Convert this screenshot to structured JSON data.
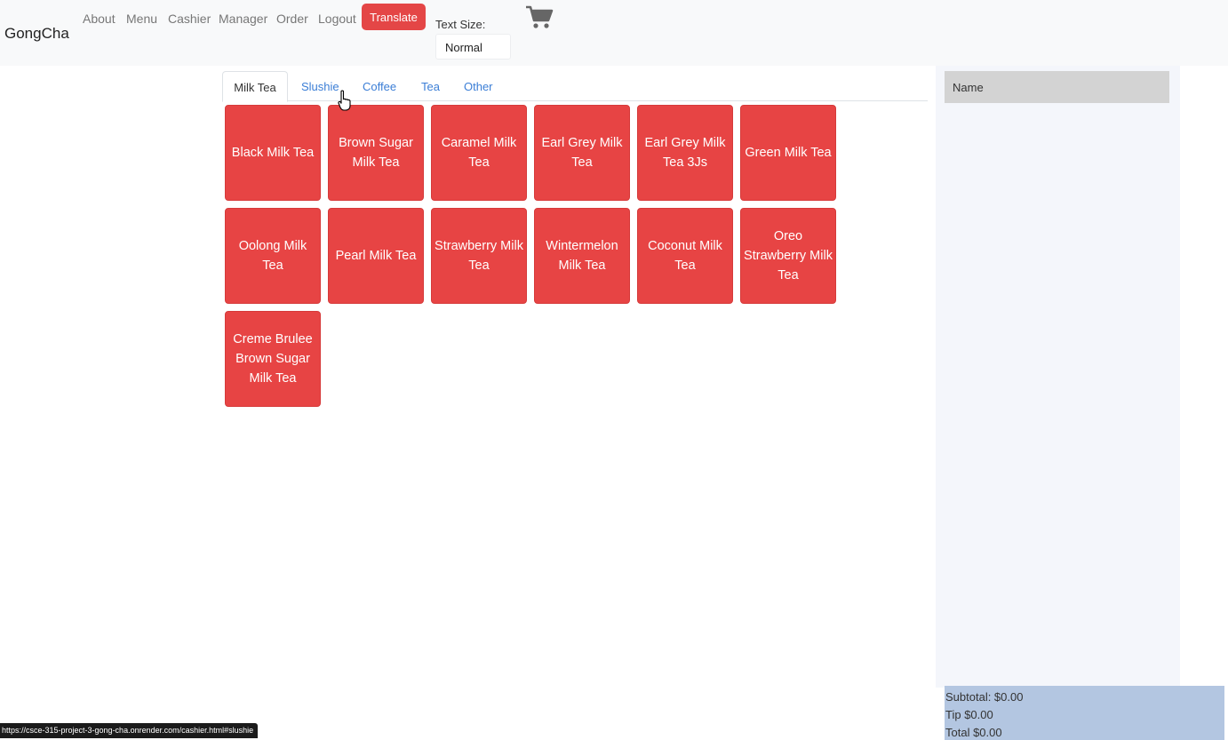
{
  "nav": {
    "brand": "GongCha",
    "links": [
      "About",
      "Menu",
      "Cashier",
      "Manager",
      "Order",
      "Logout"
    ],
    "translate": "Translate",
    "text_size_label": "Text Size:",
    "text_size_value": "Normal",
    "cart_icon": "shopping-cart-icon"
  },
  "tabs": [
    "Milk Tea",
    "Slushie",
    "Coffee",
    "Tea",
    "Other"
  ],
  "active_tab": "Milk Tea",
  "products": [
    "Black Milk Tea",
    "Brown Sugar Milk Tea",
    "Caramel Milk Tea",
    "Earl Grey Milk Tea",
    "Earl Grey Milk Tea 3Js",
    "Green Milk Tea",
    "Oolong Milk Tea",
    "Pearl Milk Tea",
    "Strawberry Milk Tea",
    "Wintermelon Milk Tea",
    "Coconut Milk Tea",
    "Oreo Strawberry Milk Tea",
    "Creme Brulee Brown Sugar Milk Tea"
  ],
  "order": {
    "header": "Name",
    "subtotal": "Subtotal: $0.00",
    "tip": "Tip $0.00",
    "total": "Total $0.00"
  },
  "status_url": "https://csce-315-project-3-gong-cha.onrender.com/cashier.html#slushie",
  "colors": {
    "accent": "#e74444",
    "link": "#3b7ed6",
    "navbar_bg": "#f8f9fa",
    "totals_bg": "#b3c6e1"
  }
}
